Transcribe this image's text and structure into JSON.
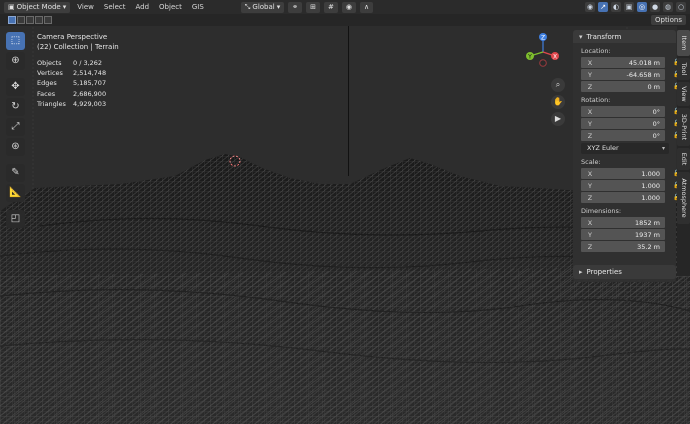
{
  "header": {
    "mode": "Object Mode",
    "menus": [
      "View",
      "Select",
      "Add",
      "Object",
      "GIS"
    ],
    "transform_orientation": "Global",
    "options_label": "Options"
  },
  "viewport": {
    "view_name": "Camera Perspective",
    "collection": "(22) Collection | Terrain",
    "stats": [
      {
        "label": "Objects",
        "value": "0 / 3,262"
      },
      {
        "label": "Vertices",
        "value": "2,514,748"
      },
      {
        "label": "Edges",
        "value": "5,185,707"
      },
      {
        "label": "Faces",
        "value": "2,686,900"
      },
      {
        "label": "Triangles",
        "value": "4,929,003"
      }
    ]
  },
  "gizmo": {
    "x_label": "X",
    "y_label": "Y",
    "z_label": "Z"
  },
  "npanel": {
    "transform_title": "Transform",
    "location_label": "Location:",
    "location": [
      {
        "axis": "X",
        "value": "45.018 m"
      },
      {
        "axis": "Y",
        "value": "-64.658 m"
      },
      {
        "axis": "Z",
        "value": "0 m"
      }
    ],
    "rotation_label": "Rotation:",
    "rotation": [
      {
        "axis": "X",
        "value": "0°"
      },
      {
        "axis": "Y",
        "value": "0°"
      },
      {
        "axis": "Z",
        "value": "0°"
      }
    ],
    "rotation_mode": "XYZ Euler",
    "scale_label": "Scale:",
    "scale": [
      {
        "axis": "X",
        "value": "1.000"
      },
      {
        "axis": "Y",
        "value": "1.000"
      },
      {
        "axis": "Z",
        "value": "1.000"
      }
    ],
    "dimensions_label": "Dimensions:",
    "dimensions": [
      {
        "axis": "X",
        "value": "1852 m"
      },
      {
        "axis": "Y",
        "value": "1937 m"
      },
      {
        "axis": "Z",
        "value": "35.2 m"
      }
    ],
    "properties_title": "Properties"
  },
  "tabs": [
    "Item",
    "Tool",
    "View",
    "3D-Print",
    "Edit",
    "Atmosphere"
  ],
  "colors": {
    "accent": "#4772b3",
    "x_axis": "#e0474c",
    "y_axis": "#7fbf2e",
    "z_axis": "#3f7fe0"
  }
}
